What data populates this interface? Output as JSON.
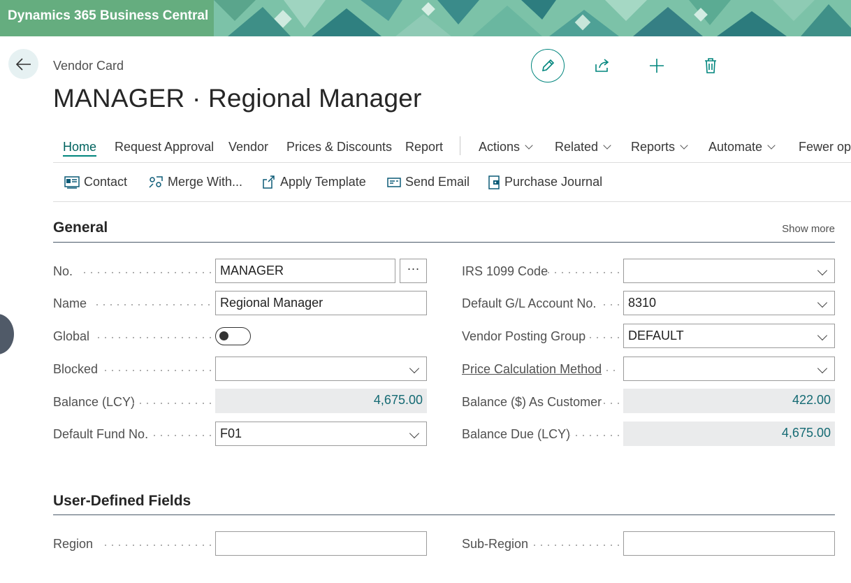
{
  "app": {
    "title": "Dynamics 365 Business Central"
  },
  "page": {
    "breadcrumb": "Vendor Card",
    "title": "MANAGER · Regional Manager"
  },
  "actionbar": {
    "items": [
      "Home",
      "Request Approval",
      "Vendor",
      "Prices & Discounts",
      "Report"
    ],
    "menus": [
      "Actions",
      "Related",
      "Reports",
      "Automate"
    ],
    "fewer_options": "Fewer options"
  },
  "promoted": [
    "Contact",
    "Merge With...",
    "Apply Template",
    "Send Email",
    "Purchase Journal"
  ],
  "general": {
    "title": "General",
    "show_more": "Show more",
    "left": {
      "no": {
        "label": "No.",
        "value": "MANAGER",
        "assist": "···"
      },
      "name": {
        "label": "Name",
        "value": "Regional Manager"
      },
      "global": {
        "label": "Global",
        "value": false
      },
      "blocked": {
        "label": "Blocked",
        "value": ""
      },
      "balance": {
        "label": "Balance (LCY)",
        "value": "4,675.00"
      },
      "fund": {
        "label": "Default Fund No.",
        "value": "F01"
      }
    },
    "right": {
      "irs": {
        "label": "IRS 1099 Code",
        "value": ""
      },
      "gl": {
        "label": "Default G/L Account No.",
        "value": "8310"
      },
      "posting": {
        "label": "Vendor Posting Group",
        "value": "DEFAULT"
      },
      "price": {
        "label": "Price Calculation Method",
        "value": ""
      },
      "bal_cust": {
        "label": "Balance ($) As Customer",
        "value": "422.00"
      },
      "bal_due": {
        "label": "Balance Due (LCY)",
        "value": "4,675.00"
      }
    }
  },
  "user_defined": {
    "title": "User-Defined Fields",
    "region": {
      "label": "Region",
      "value": ""
    },
    "sub_region": {
      "label": "Sub-Region",
      "value": ""
    }
  },
  "colors": {
    "accent": "#00857d",
    "banner_green": "#65ad7f",
    "readonly_bg": "#eaebec"
  }
}
